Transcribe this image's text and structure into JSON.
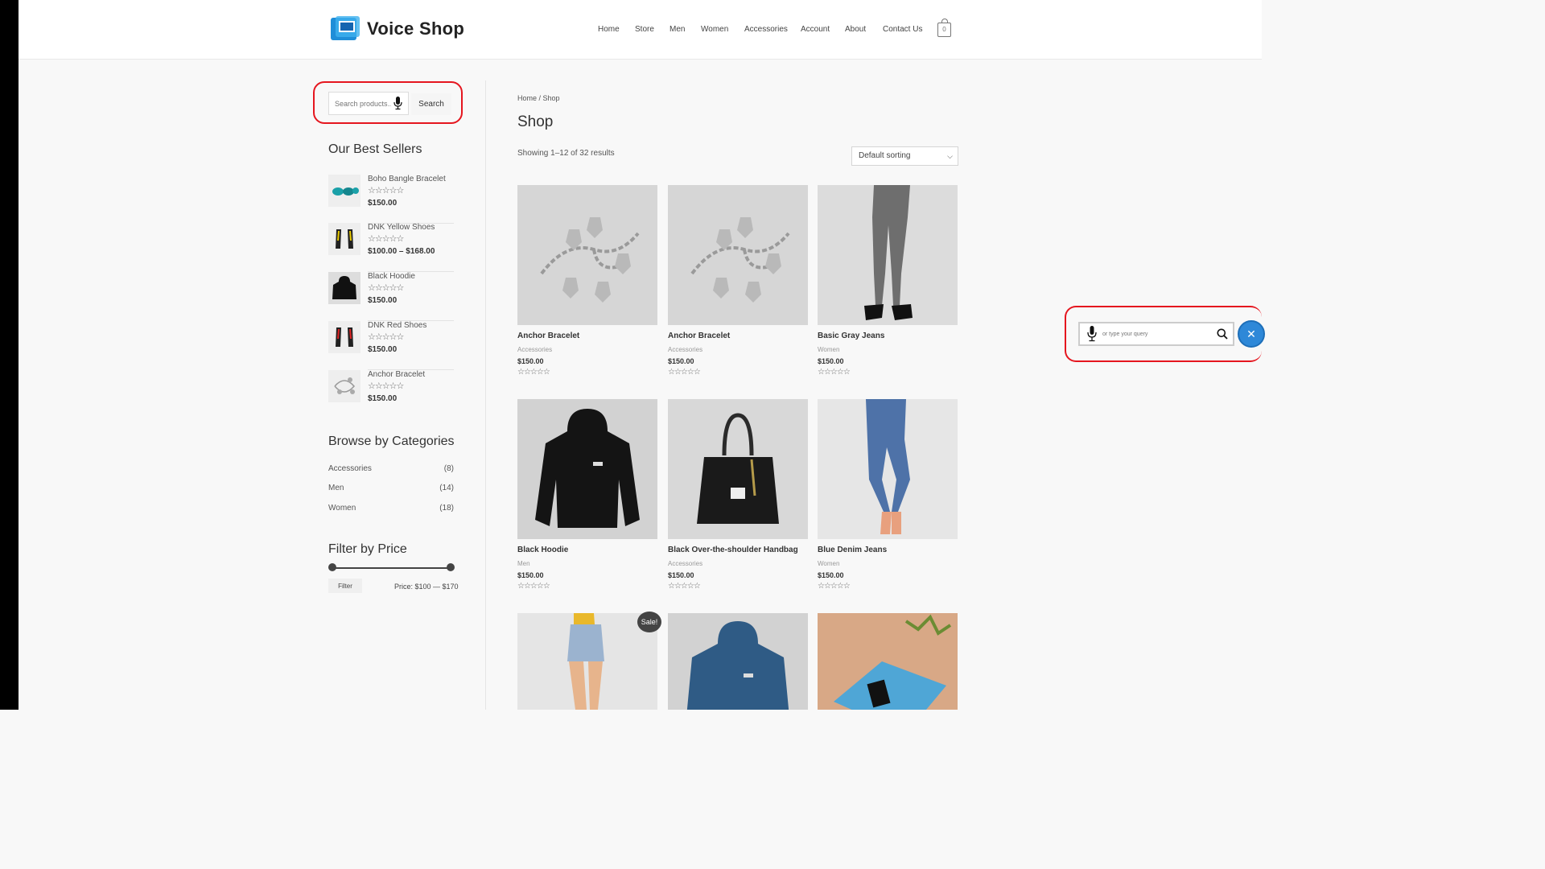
{
  "header": {
    "logo_text": "Voice Shop",
    "nav": [
      "Home",
      "Store",
      "Men",
      "Women",
      "Accessories",
      "Account",
      "About",
      "Contact Us"
    ],
    "cart_count": "0"
  },
  "sidebar": {
    "search": {
      "placeholder": "Search products…",
      "button": "Search"
    },
    "best_sellers": {
      "title": "Our Best Sellers",
      "items": [
        {
          "name": "Boho Bangle Bracelet",
          "price": "$150.00"
        },
        {
          "name": "DNK Yellow Shoes",
          "price": "$100.00 – $168.00"
        },
        {
          "name": "Black Hoodie",
          "price": "$150.00"
        },
        {
          "name": "DNK Red Shoes",
          "price": "$150.00"
        },
        {
          "name": "Anchor Bracelet",
          "price": "$150.00"
        }
      ]
    },
    "categories": {
      "title": "Browse by Categories",
      "items": [
        {
          "name": "Accessories",
          "count": "(8)"
        },
        {
          "name": "Men",
          "count": "(14)"
        },
        {
          "name": "Women",
          "count": "(18)"
        }
      ]
    },
    "price_filter": {
      "title": "Filter by Price",
      "button": "Filter",
      "label": "Price: $100 — $170"
    }
  },
  "main": {
    "breadcrumb": "Home / Shop",
    "title": "Shop",
    "results": "Showing 1–12 of 32 results",
    "sort": "Default sorting",
    "products": [
      {
        "name": "Anchor Bracelet",
        "category": "Accessories",
        "price": "$150.00"
      },
      {
        "name": "Anchor Bracelet",
        "category": "Accessories",
        "price": "$150.00"
      },
      {
        "name": "Basic Gray Jeans",
        "category": "Women",
        "price": "$150.00"
      },
      {
        "name": "Black Hoodie",
        "category": "Men",
        "price": "$150.00"
      },
      {
        "name": "Black Over-the-shoulder Handbag",
        "category": "Accessories",
        "price": "$150.00"
      },
      {
        "name": "Blue Denim Jeans",
        "category": "Women",
        "price": "$150.00"
      }
    ],
    "sale_badge": "Sale!"
  },
  "voice_widget": {
    "placeholder": "or type your query"
  },
  "stars": "☆☆☆☆☆",
  "colors": {
    "highlight_outline": "#e5161f",
    "voice_button": "#2e88d8",
    "logo_blue": "#1f8ed8"
  }
}
